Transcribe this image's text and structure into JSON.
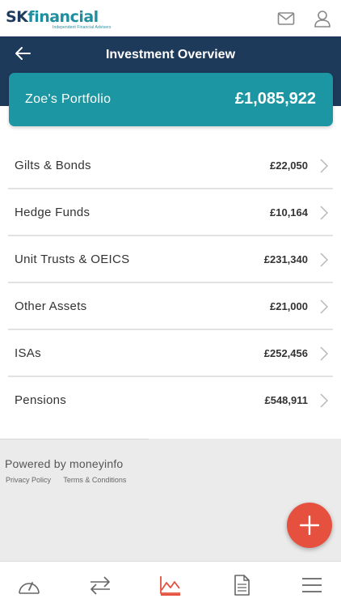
{
  "brand": {
    "name_bold": "SK",
    "name_rest": "financial",
    "tagline": "Independent Financial Advisers"
  },
  "topbar": {
    "icons": [
      "mail-icon",
      "user-icon"
    ]
  },
  "header": {
    "title": "Investment Overview",
    "back_icon": "arrow-left-icon"
  },
  "portfolio": {
    "name": "Zoe's Portfolio",
    "value": "£1,085,922"
  },
  "categories": [
    {
      "label": "Gilts & Bonds",
      "value": "£22,050"
    },
    {
      "label": "Hedge Funds",
      "value": "£10,164"
    },
    {
      "label": "Unit Trusts & OEICS",
      "value": "£231,340"
    },
    {
      "label": "Other Assets",
      "value": "£21,000"
    },
    {
      "label": "ISAs",
      "value": "£252,456"
    },
    {
      "label": "Pensions",
      "value": "£548,911"
    }
  ],
  "footer": {
    "powered": "Powered by moneyinfo",
    "privacy": "Privacy Policy",
    "terms": "Terms & Conditions"
  },
  "fab": {
    "icon": "plus-icon"
  },
  "tabbar": {
    "tabs": [
      "dashboard-icon",
      "transfer-icon",
      "chart-icon",
      "document-icon",
      "menu-icon"
    ],
    "active": "chart-icon"
  },
  "colors": {
    "navy": "#1d3a5a",
    "teal": "#1b96a2",
    "accent": "#e6503f"
  }
}
